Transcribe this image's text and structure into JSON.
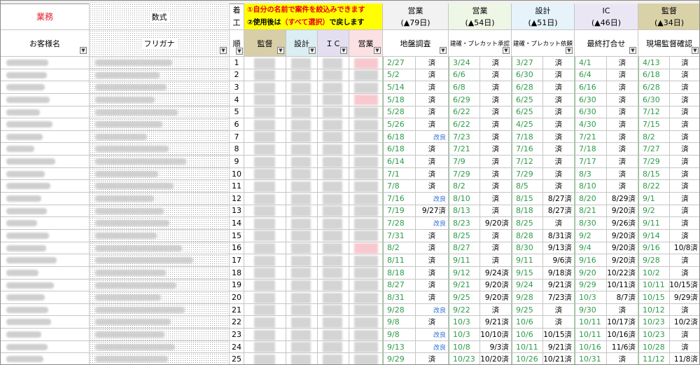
{
  "header": {
    "gyomu": "業務",
    "bukken": "数式",
    "ko": "着",
    "kou": "工",
    "jun": "順",
    "notice1": "①自分の名前で案件を絞込みできます",
    "notice2a": "②使用後は",
    "notice2b": "（すべて選択）",
    "notice2c": "で戻します",
    "customer": "お客様名",
    "furigana": "フリガナ",
    "roles": [
      "監督",
      "設計",
      "ＩＣ",
      "営業"
    ],
    "groups": [
      {
        "title": "営業",
        "days": "(▲79日)",
        "sub": "地盤調査"
      },
      {
        "title": "営業",
        "days": "(▲54日)",
        "sub": "建確・プレカット承認"
      },
      {
        "title": "設計",
        "days": "(▲51日)",
        "sub": "建確・プレカット依頼"
      },
      {
        "title": "IC",
        "days": "(▲46日)",
        "sub": "最終打合せ"
      },
      {
        "title": "監督",
        "days": "(▲34日)",
        "sub": "現場監督確認"
      }
    ]
  },
  "rows": [
    {
      "n": "1",
      "c": [
        [
          "2/27",
          "済"
        ],
        [
          "3/24",
          "済"
        ],
        [
          "3/27",
          "済"
        ],
        [
          "4/1",
          "済"
        ],
        [
          "4/13",
          "済"
        ]
      ],
      "pink": true
    },
    {
      "n": "2",
      "c": [
        [
          "5/2",
          "済"
        ],
        [
          "6/6",
          "済"
        ],
        [
          "6/30",
          "済"
        ],
        [
          "6/4",
          "済"
        ],
        [
          "6/18",
          "済"
        ]
      ]
    },
    {
      "n": "3",
      "c": [
        [
          "5/14",
          "済"
        ],
        [
          "6/8",
          "済"
        ],
        [
          "6/28",
          "済"
        ],
        [
          "6/16",
          "済"
        ],
        [
          "6/28",
          "済"
        ]
      ]
    },
    {
      "n": "4",
      "c": [
        [
          "5/18",
          "済"
        ],
        [
          "6/29",
          "済"
        ],
        [
          "6/25",
          "済"
        ],
        [
          "6/30",
          "済"
        ],
        [
          "6/30",
          "済"
        ]
      ],
      "pink": true
    },
    {
      "n": "5",
      "c": [
        [
          "5/28",
          "済"
        ],
        [
          "6/22",
          "済"
        ],
        [
          "6/25",
          "済"
        ],
        [
          "6/30",
          "済"
        ],
        [
          "7/12",
          "済"
        ]
      ]
    },
    {
      "n": "6",
      "c": [
        [
          "5/26",
          "済"
        ],
        [
          "6/22",
          "済"
        ],
        [
          "4/25",
          "済"
        ],
        [
          "4/30",
          "済"
        ],
        [
          "7/15",
          "済"
        ]
      ]
    },
    {
      "n": "7",
      "c": [
        [
          "6/18",
          "改良"
        ],
        [
          "7/23",
          "済"
        ],
        [
          "7/18",
          "済"
        ],
        [
          "7/21",
          "済"
        ],
        [
          "8/2",
          "済"
        ]
      ]
    },
    {
      "n": "8",
      "c": [
        [
          "6/18",
          "済"
        ],
        [
          "7/21",
          "済"
        ],
        [
          "7/16",
          "済"
        ],
        [
          "7/18",
          "済"
        ],
        [
          "7/27",
          "済"
        ]
      ]
    },
    {
      "n": "9",
      "c": [
        [
          "6/14",
          "済"
        ],
        [
          "7/9",
          "済"
        ],
        [
          "7/12",
          "済"
        ],
        [
          "7/17",
          "済"
        ],
        [
          "7/29",
          "済"
        ]
      ]
    },
    {
      "n": "10",
      "c": [
        [
          "7/1",
          "済"
        ],
        [
          "7/29",
          "済"
        ],
        [
          "7/29",
          "済"
        ],
        [
          "8/3",
          "済"
        ],
        [
          "8/15",
          "済"
        ]
      ]
    },
    {
      "n": "11",
      "c": [
        [
          "7/8",
          "済"
        ],
        [
          "8/2",
          "済"
        ],
        [
          "8/5",
          "済"
        ],
        [
          "8/10",
          "済"
        ],
        [
          "8/22",
          "済"
        ]
      ]
    },
    {
      "n": "12",
      "c": [
        [
          "7/16",
          "改良"
        ],
        [
          "8/10",
          "済"
        ],
        [
          "8/15",
          "8/27済"
        ],
        [
          "8/20",
          "8/29済"
        ],
        [
          "9/1",
          "済"
        ]
      ]
    },
    {
      "n": "13",
      "c": [
        [
          "7/19",
          "9/27済"
        ],
        [
          "8/13",
          "済"
        ],
        [
          "8/18",
          "8/27済"
        ],
        [
          "8/21",
          "9/20済"
        ],
        [
          "9/2",
          "済"
        ]
      ]
    },
    {
      "n": "14",
      "c": [
        [
          "7/28",
          "改良"
        ],
        [
          "8/23",
          "9/20済"
        ],
        [
          "8/25",
          "済"
        ],
        [
          "8/30",
          "9/26済"
        ],
        [
          "9/11",
          "済"
        ]
      ]
    },
    {
      "n": "15",
      "c": [
        [
          "7/31",
          "済"
        ],
        [
          "8/25",
          "済"
        ],
        [
          "8/28",
          "8/31済"
        ],
        [
          "9/2",
          "9/20済"
        ],
        [
          "9/14",
          "済"
        ]
      ]
    },
    {
      "n": "16",
      "c": [
        [
          "8/2",
          "済"
        ],
        [
          "8/27",
          "済"
        ],
        [
          "8/30",
          "9/13済"
        ],
        [
          "9/4",
          "9/20済"
        ],
        [
          "9/16",
          "10/8済"
        ]
      ],
      "pink": true
    },
    {
      "n": "17",
      "c": [
        [
          "8/11",
          "済"
        ],
        [
          "9/11",
          "済"
        ],
        [
          "9/11",
          "9/6済"
        ],
        [
          "9/16",
          "9/20済"
        ],
        [
          "9/28",
          "済"
        ]
      ]
    },
    {
      "n": "18",
      "c": [
        [
          "8/18",
          "済"
        ],
        [
          "9/12",
          "9/24済"
        ],
        [
          "9/15",
          "9/18済"
        ],
        [
          "9/20",
          "10/22済"
        ],
        [
          "10/2",
          "済"
        ]
      ]
    },
    {
      "n": "19",
      "c": [
        [
          "8/27",
          "済"
        ],
        [
          "9/21",
          "9/20済"
        ],
        [
          "9/24",
          "9/21済"
        ],
        [
          "9/29",
          "10/11済"
        ],
        [
          "10/11",
          "10/15済"
        ]
      ]
    },
    {
      "n": "20",
      "c": [
        [
          "8/31",
          "済"
        ],
        [
          "9/25",
          "9/20済"
        ],
        [
          "9/28",
          "7/23済"
        ],
        [
          "10/3",
          "8/7済"
        ],
        [
          "10/15",
          "9/29済"
        ]
      ]
    },
    {
      "n": "21",
      "c": [
        [
          "9/28",
          "改良"
        ],
        [
          "9/22",
          "済"
        ],
        [
          "9/25",
          "済"
        ],
        [
          "9/30",
          "済"
        ],
        [
          "10/12",
          "済"
        ]
      ]
    },
    {
      "n": "22",
      "c": [
        [
          "9/8",
          "済"
        ],
        [
          "10/3",
          "9/21済"
        ],
        [
          "10/6",
          "済"
        ],
        [
          "10/11",
          "10/17済"
        ],
        [
          "10/23",
          "10/2済"
        ]
      ]
    },
    {
      "n": "23",
      "c": [
        [
          "9/8",
          "改良"
        ],
        [
          "10/3",
          "10/10済"
        ],
        [
          "10/6",
          "10/15済"
        ],
        [
          "10/11",
          "10/16済"
        ],
        [
          "10/23",
          "済"
        ]
      ]
    },
    {
      "n": "24",
      "c": [
        [
          "9/13",
          "改良"
        ],
        [
          "10/8",
          "9/3済"
        ],
        [
          "10/11",
          "9/21済"
        ],
        [
          "10/16",
          "11/6済"
        ],
        [
          "10/28",
          "済"
        ]
      ]
    },
    {
      "n": "25",
      "c": [
        [
          "9/29",
          "済"
        ],
        [
          "10/23",
          "10/20済"
        ],
        [
          "10/26",
          "10/21済"
        ],
        [
          "10/31",
          "済"
        ],
        [
          "11/12",
          "11/8済"
        ]
      ]
    }
  ]
}
